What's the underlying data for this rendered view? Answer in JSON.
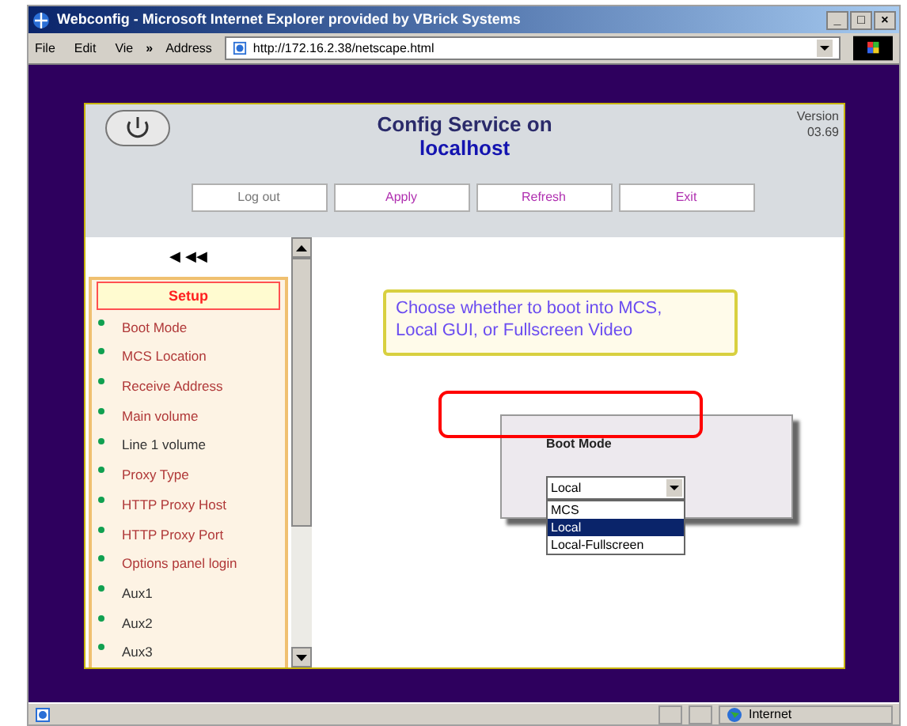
{
  "window": {
    "title": "Webconfig - Microsoft Internet Explorer provided by VBrick Systems",
    "controls": [
      "_",
      "□",
      "×"
    ]
  },
  "menu": [
    {
      "label": "File"
    },
    {
      "label": "Edit"
    },
    {
      "label": "Vie"
    }
  ],
  "menu_more": "»",
  "address": {
    "label": "Address",
    "value": "http://172.16.2.38/netscape.html"
  },
  "header": {
    "title": "Config Service on",
    "host": "localhost",
    "version_label": "Version",
    "version": "03.69",
    "buttons": [
      {
        "label": "Log out",
        "disabled": true
      },
      {
        "label": "Apply",
        "disabled": false
      },
      {
        "label": "Refresh",
        "disabled": false
      },
      {
        "label": "Exit",
        "disabled": false
      }
    ]
  },
  "sidebar": {
    "arrows": [
      "◀",
      "◀◀"
    ],
    "section": "Setup",
    "items": [
      {
        "label": "Boot Mode",
        "kind": "link"
      },
      {
        "label": "MCS Location",
        "kind": "link"
      },
      {
        "label": "Receive Address",
        "kind": "link"
      },
      {
        "label": "Main volume",
        "kind": "link"
      },
      {
        "label": "Line 1 volume",
        "kind": "plain"
      },
      {
        "label": "Proxy Type",
        "kind": "link"
      },
      {
        "label": "HTTP Proxy Host",
        "kind": "link"
      },
      {
        "label": "HTTP Proxy Port",
        "kind": "link"
      },
      {
        "label": "Options panel login",
        "kind": "link"
      },
      {
        "label": "Aux1",
        "kind": "plain"
      },
      {
        "label": "Aux2",
        "kind": "plain"
      },
      {
        "label": "Aux3",
        "kind": "plain"
      }
    ]
  },
  "hint": "Choose whether to boot into MCS, Local GUI, or Fullscreen Video",
  "dialog": {
    "label": "Boot Mode",
    "value": "Local",
    "options": [
      {
        "label": "MCS",
        "selected": false
      },
      {
        "label": "Local",
        "selected": true
      },
      {
        "label": "Local-Fullscreen",
        "selected": false
      }
    ]
  },
  "status_bar": {
    "zone": "Internet"
  }
}
